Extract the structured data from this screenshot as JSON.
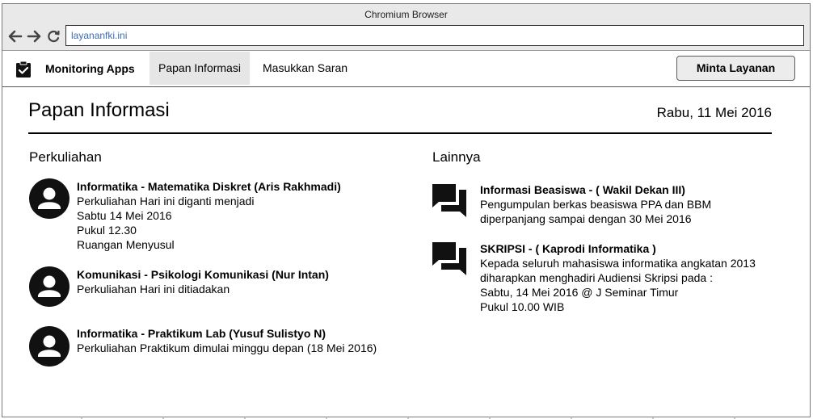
{
  "browser": {
    "title": "Chromium Browser",
    "url": "layananfki.ini"
  },
  "appbar": {
    "app_name": "Monitoring Apps",
    "tabs": [
      {
        "label": "Papan Informasi",
        "active": true
      },
      {
        "label": "Masukkan Saran",
        "active": false
      }
    ],
    "request_button": "Minta Layanan"
  },
  "page": {
    "title": "Papan Informasi",
    "date": "Rabu, 11 Mei 2016"
  },
  "perkuliahan": {
    "heading": "Perkuliahan",
    "items": [
      {
        "title": "Informatika - Matematika Diskret (Aris Rakhmadi)",
        "lines": [
          "Perkuliahan Hari ini diganti menjadi",
          "Sabtu 14 Mei 2016",
          "Pukul 12.30",
          "Ruangan Menyusul"
        ]
      },
      {
        "title": "Komunikasi - Psikologi Komunikasi (Nur Intan)",
        "lines": [
          "Perkuliahan Hari ini ditiadakan"
        ]
      },
      {
        "title": "Informatika - Praktikum Lab (Yusuf Sulistyo N)",
        "lines": [
          "Perkuliahan Praktikum dimulai minggu depan (18 Mei 2016)"
        ]
      }
    ]
  },
  "lainnya": {
    "heading": "Lainnya",
    "items": [
      {
        "title": "Informasi Beasiswa - ( Wakil Dekan III)",
        "lines": [
          "Pengumpulan berkas beasiswa PPA dan BBM",
          "diperpanjang sampai dengan 30 Mei 2016"
        ]
      },
      {
        "title": "SKRIPSI - ( Kaprodi Informatika )",
        "lines": [
          "Kepada seluruh mahasiswa informatika angkatan 2013",
          "diharapkan menghadiri Audiensi Skripsi pada :",
          "Sabtu, 14 Mei 2016 @ J Seminar Timur",
          "Pukul 10.00 WIB"
        ]
      }
    ]
  },
  "icons": {
    "back": "arrow-left-icon",
    "forward": "arrow-right-icon",
    "reload": "reload-icon",
    "app": "clipboard-check-icon",
    "person": "account-circle-icon",
    "message": "forum-icon"
  },
  "colors": {
    "url_text": "#3b6cb3",
    "active_tab_bg": "#e6e6e6",
    "chrome_bg": "#e9e9e9"
  }
}
